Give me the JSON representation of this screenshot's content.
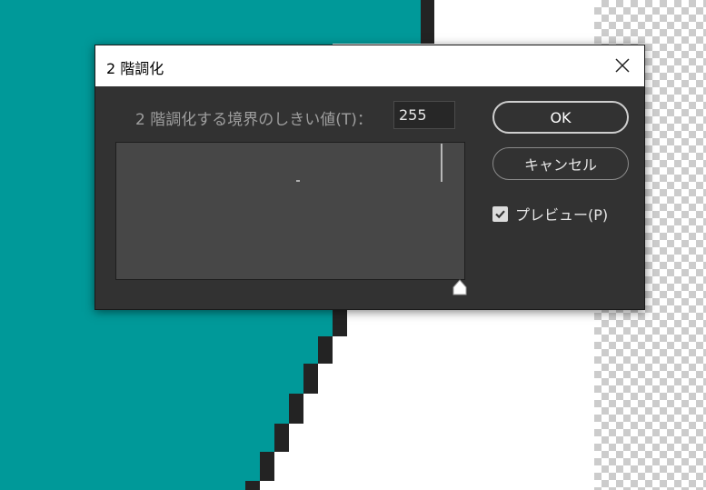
{
  "colors": {
    "teal": "#009999",
    "dark_edge": "#232323",
    "dialog_bg": "#323232",
    "histogram_bg": "#474747"
  },
  "dialog": {
    "title": "2 階調化",
    "close_icon": "close-icon",
    "threshold_label": "2 階調化する境界のしきい値(T)：",
    "threshold_value": "255",
    "slider_icon": "triangle-slider-icon",
    "ok_label": "OK",
    "cancel_label": "キャンセル",
    "preview_label": "プレビュー(P)",
    "preview_checked": true,
    "check_icon": "checkmark-icon"
  }
}
